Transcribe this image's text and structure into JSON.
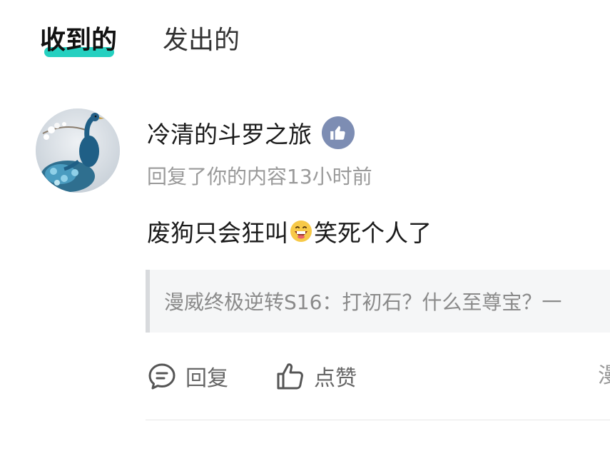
{
  "tabs": {
    "received": "收到的",
    "sent": "发出的"
  },
  "notification": {
    "username": "冷清的斗罗之旅",
    "badge_icon": "thumbs-up-icon",
    "meta": "回复了你的内容13小时前",
    "comment_before_emoji": "废狗只会狂叫",
    "emoji": "grinning-face-emoji",
    "comment_after_emoji": "笑死个人了",
    "quoted_content": "漫威终极逆转S16：打初石？什么至尊宝？一",
    "actions": {
      "reply_icon": "comment-icon",
      "reply_label": "回复",
      "like_icon": "thumbs-up-outline-icon",
      "like_label": "点赞",
      "truncated_label": "漫"
    }
  },
  "colors": {
    "accent_underline": "#25d0c0",
    "badge_bg": "#7d8db3",
    "meta_text": "#9a9a9a"
  }
}
